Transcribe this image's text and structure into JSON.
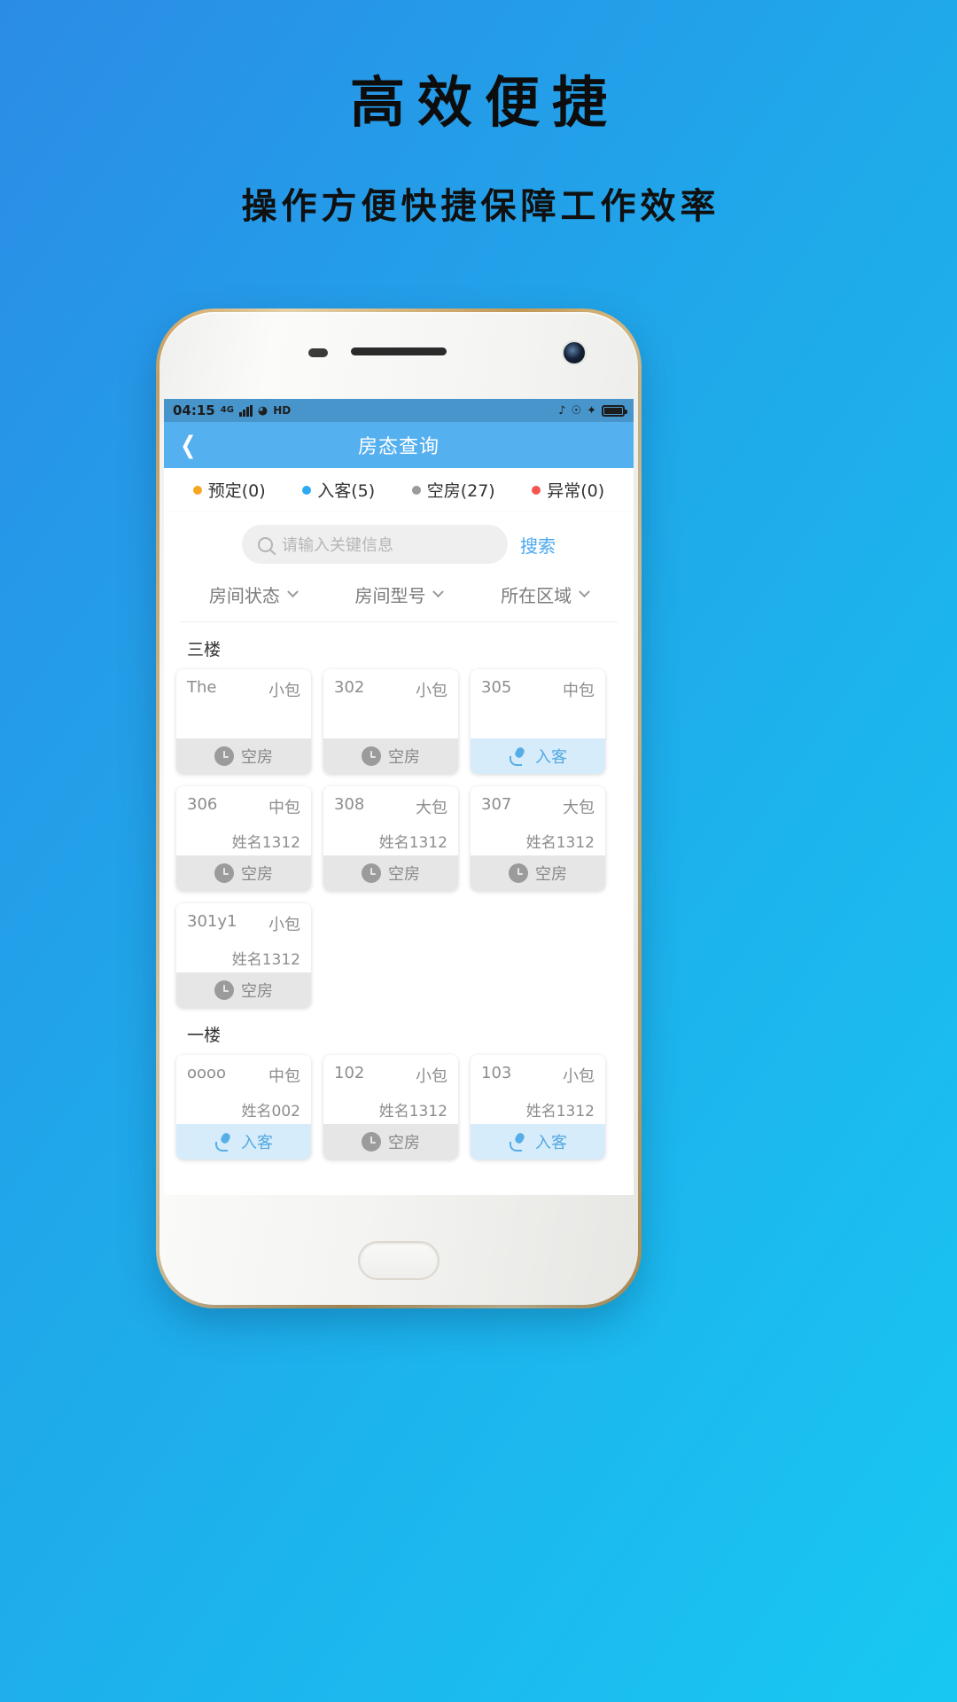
{
  "promo": {
    "headline": "高效便捷",
    "subhead": "操作方便快捷保障工作效率"
  },
  "statusbar": {
    "time": "04:15",
    "network": "4G",
    "hd": "HD"
  },
  "appbar": {
    "back_icon": "chevron-left-icon",
    "title": "房态查询"
  },
  "tabs": [
    {
      "label": "预定(0)",
      "color": "#f5a623"
    },
    {
      "label": "入客(5)",
      "color": "#2eaaf0"
    },
    {
      "label": "空房(27)",
      "color": "#9a9a9a"
    },
    {
      "label": "异常(0)",
      "color": "#f2564f"
    }
  ],
  "search": {
    "placeholder": "请输入关键信息",
    "value": "",
    "button": "搜索",
    "icon": "search-icon"
  },
  "filters": [
    {
      "label": "房间状态"
    },
    {
      "label": "房间型号"
    },
    {
      "label": "所在区域"
    }
  ],
  "floors": [
    {
      "name": "三楼",
      "rooms": [
        {
          "no": "The",
          "type": "小包",
          "guest": "",
          "status": "空房",
          "state": "empty"
        },
        {
          "no": "302",
          "type": "小包",
          "guest": "",
          "status": "空房",
          "state": "empty"
        },
        {
          "no": "305",
          "type": "中包",
          "guest": "",
          "status": "入客",
          "state": "in"
        },
        {
          "no": "306",
          "type": "中包",
          "guest": "姓名1312",
          "status": "空房",
          "state": "empty"
        },
        {
          "no": "308",
          "type": "大包",
          "guest": "姓名1312",
          "status": "空房",
          "state": "empty"
        },
        {
          "no": "307",
          "type": "大包",
          "guest": "姓名1312",
          "status": "空房",
          "state": "empty"
        },
        {
          "no": "301y1",
          "type": "小包",
          "guest": "姓名1312",
          "status": "空房",
          "state": "empty"
        }
      ]
    },
    {
      "name": "一楼",
      "rooms": [
        {
          "no": "oooo",
          "type": "中包",
          "guest": "姓名002",
          "status": "入客",
          "state": "in"
        },
        {
          "no": "102",
          "type": "小包",
          "guest": "姓名1312",
          "status": "空房",
          "state": "empty"
        },
        {
          "no": "103",
          "type": "小包",
          "guest": "姓名1312",
          "status": "入客",
          "state": "in"
        }
      ]
    }
  ],
  "colors": {
    "brand": "#55b0ef",
    "accent": "#4aa8ef",
    "bg_top": "#2b8ce6",
    "bg_bottom": "#18c8f2"
  }
}
